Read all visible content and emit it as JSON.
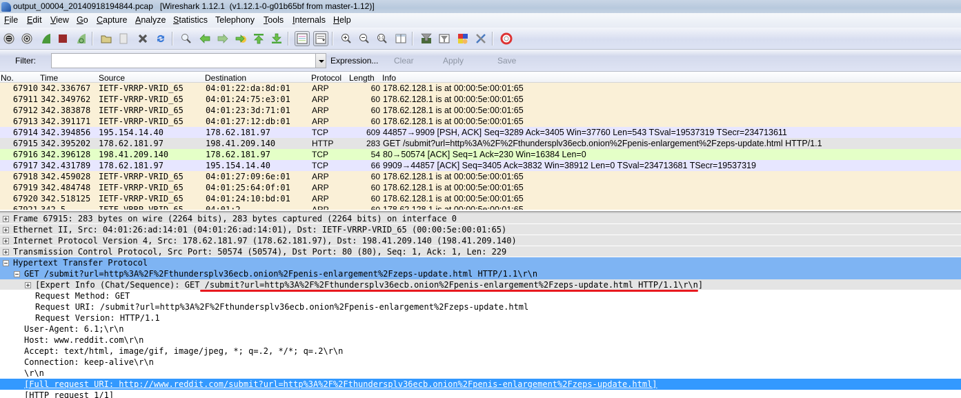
{
  "window": {
    "title": "output_00004_20140918194844.pcap   [Wireshark 1.12.1  (v1.12.1-0-g01b65bf from master-1.12)]"
  },
  "menubar": {
    "items": [
      {
        "label": "File",
        "accel": "F",
        "rest": "ile"
      },
      {
        "label": "Edit",
        "accel": "E",
        "rest": "dit"
      },
      {
        "label": "View",
        "accel": "V",
        "rest": "iew"
      },
      {
        "label": "Go",
        "accel": "G",
        "rest": "o"
      },
      {
        "label": "Capture",
        "accel": "C",
        "rest": "apture"
      },
      {
        "label": "Analyze",
        "accel": "A",
        "rest": "nalyze"
      },
      {
        "label": "Statistics",
        "accel": "S",
        "rest": "tatistics"
      },
      {
        "label": "Telephony",
        "accel": "",
        "rest": "Telephony"
      },
      {
        "label": "Tools",
        "accel": "T",
        "rest": "ools"
      },
      {
        "label": "Internals",
        "accel": "I",
        "rest": "nternals"
      },
      {
        "label": "Help",
        "accel": "H",
        "rest": "elp"
      }
    ]
  },
  "toolbar": {
    "buttons": [
      "interfaces-icon",
      "capture-options-icon",
      "start-capture-icon",
      "stop-capture-icon",
      "restart-capture-icon",
      "open-file-icon",
      "save-file-icon",
      "close-file-icon",
      "reload-icon",
      "find-packet-icon",
      "go-back-icon",
      "go-forward-icon",
      "go-to-packet-icon",
      "first-packet-icon",
      "last-packet-icon",
      "colorize-icon",
      "auto-scroll-icon",
      "zoom-in-icon",
      "zoom-out-icon",
      "normal-size-icon",
      "resize-columns-icon",
      "capture-filters-icon",
      "display-filters-icon",
      "coloring-rules-icon",
      "preferences-icon",
      "help-icon"
    ]
  },
  "filter": {
    "label": "Filter:",
    "value": "",
    "expression_label": "Expression...",
    "clear_label": "Clear",
    "apply_label": "Apply",
    "save_label": "Save"
  },
  "packet_list": {
    "columns": [
      "No.",
      "Time",
      "Source",
      "Destination",
      "Protocol",
      "Length",
      "Info"
    ],
    "colors": {
      "arp": "#faf0d7",
      "tcp": "#e7e6ff",
      "http": "#e4e4e4",
      "tcp_ack": "#e4ffc7"
    },
    "rows": [
      {
        "no": "67910",
        "time": "342.336767",
        "src": "IETF-VRRP-VRID_65",
        "dst": "04:01:22:da:8d:01",
        "proto": "ARP",
        "len": "60",
        "info": "178.62.128.1 is at 00:00:5e:00:01:65",
        "color": "arp"
      },
      {
        "no": "67911",
        "time": "342.349762",
        "src": "IETF-VRRP-VRID_65",
        "dst": "04:01:24:75:e3:01",
        "proto": "ARP",
        "len": "60",
        "info": "178.62.128.1 is at 00:00:5e:00:01:65",
        "color": "arp"
      },
      {
        "no": "67912",
        "time": "342.383878",
        "src": "IETF-VRRP-VRID_65",
        "dst": "04:01:23:3d:71:01",
        "proto": "ARP",
        "len": "60",
        "info": "178.62.128.1 is at 00:00:5e:00:01:65",
        "color": "arp"
      },
      {
        "no": "67913",
        "time": "342.391171",
        "src": "IETF-VRRP-VRID_65",
        "dst": "04:01:27:12:db:01",
        "proto": "ARP",
        "len": "60",
        "info": "178.62.128.1 is at 00:00:5e:00:01:65",
        "color": "arp"
      },
      {
        "no": "67914",
        "time": "342.394856",
        "src": "195.154.14.40",
        "dst": "178.62.181.97",
        "proto": "TCP",
        "len": "609",
        "info": "44857→9909 [PSH, ACK] Seq=3289 Ack=3405 Win=37760 Len=543 TSval=19537319 TSecr=234713611",
        "color": "tcp"
      },
      {
        "no": "67915",
        "time": "342.395202",
        "src": "178.62.181.97",
        "dst": "198.41.209.140",
        "proto": "HTTP",
        "len": "283",
        "info": "GET /submit?url=http%3A%2F%2Fthundersplv36ecb.onion%2Fpenis-enlargement%2Fzeps-update.html HTTP/1.1",
        "color": "http"
      },
      {
        "no": "67916",
        "time": "342.396128",
        "src": "198.41.209.140",
        "dst": "178.62.181.97",
        "proto": "TCP",
        "len": "54",
        "info": "80→50574 [ACK] Seq=1 Ack=230 Win=16384 Len=0",
        "color": "tcp_ack"
      },
      {
        "no": "67917",
        "time": "342.431789",
        "src": "178.62.181.97",
        "dst": "195.154.14.40",
        "proto": "TCP",
        "len": "66",
        "info": "9909→44857 [ACK] Seq=3405 Ack=3832 Win=38912 Len=0 TSval=234713681 TSecr=19537319",
        "color": "tcp"
      },
      {
        "no": "67918",
        "time": "342.459028",
        "src": "IETF-VRRP-VRID_65",
        "dst": "04:01:27:09:6e:01",
        "proto": "ARP",
        "len": "60",
        "info": "178.62.128.1 is at 00:00:5e:00:01:65",
        "color": "arp"
      },
      {
        "no": "67919",
        "time": "342.484748",
        "src": "IETF-VRRP-VRID_65",
        "dst": "04:01:25:64:0f:01",
        "proto": "ARP",
        "len": "60",
        "info": "178.62.128.1 is at 00:00:5e:00:01:65",
        "color": "arp"
      },
      {
        "no": "67920",
        "time": "342.518125",
        "src": "IETF-VRRP-VRID_65",
        "dst": "04:01:24:10:bd:01",
        "proto": "ARP",
        "len": "60",
        "info": "178.62.128.1 is at 00:00:5e:00:01:65",
        "color": "arp"
      },
      {
        "no": "67921",
        "time": "342.5",
        "src": "IETF-VRRP-VRID_65",
        "dst": "04:01:2",
        "proto": "ARP",
        "len": "60",
        "info": "178.62.128.1 is at 00:00:5e:00:01:65",
        "color": "arp",
        "partial": true
      }
    ]
  },
  "details": {
    "rows": [
      {
        "indent": 0,
        "expander": "plus",
        "style": "hdr",
        "text": "Frame 67915: 283 bytes on wire (2264 bits), 283 bytes captured (2264 bits) on interface 0"
      },
      {
        "indent": 0,
        "expander": "plus",
        "style": "hdr",
        "text": "Ethernet II, Src: 04:01:26:ad:14:01 (04:01:26:ad:14:01), Dst: IETF-VRRP-VRID_65 (00:00:5e:00:01:65)"
      },
      {
        "indent": 0,
        "expander": "plus",
        "style": "hdr",
        "text": "Internet Protocol Version 4, Src: 178.62.181.97 (178.62.181.97), Dst: 198.41.209.140 (198.41.209.140)"
      },
      {
        "indent": 0,
        "expander": "plus",
        "style": "hdr",
        "text": "Transmission Control Protocol, Src Port: 50574 (50574), Dst Port: 80 (80), Seq: 1, Ack: 1, Len: 229"
      },
      {
        "indent": 0,
        "expander": "minus",
        "style": "sel",
        "text": "Hypertext Transfer Protocol"
      },
      {
        "indent": 1,
        "expander": "minus",
        "style": "sel",
        "text": "GET /submit?url=http%3A%2F%2Fthundersplv36ecb.onion%2Fpenis-enlargement%2Fzeps-update.html HTTP/1.1\\r\\n"
      },
      {
        "indent": 2,
        "expander": "plus",
        "style": "hdr",
        "text": "[Expert Info (Chat/Sequence): GET /submit?url=http%3A%2F%2Fthundersplv36ecb.onion%2Fpenis-enlargement%2Fzeps-update.html HTTP/1.1\\r\\n]"
      },
      {
        "indent": 3,
        "expander": "",
        "style": "",
        "text": "Request Method: GET"
      },
      {
        "indent": 3,
        "expander": "",
        "style": "",
        "text": "Request URI: /submit?url=http%3A%2F%2Fthundersplv36ecb.onion%2Fpenis-enlargement%2Fzeps-update.html"
      },
      {
        "indent": 3,
        "expander": "",
        "style": "",
        "text": "Request Version: HTTP/1.1"
      },
      {
        "indent": 2,
        "expander": "",
        "style": "",
        "text": "User-Agent: 6.1;\\r\\n"
      },
      {
        "indent": 2,
        "expander": "",
        "style": "",
        "text": "Host: www.reddit.com\\r\\n"
      },
      {
        "indent": 2,
        "expander": "",
        "style": "",
        "text": "Accept: text/html, image/gif, image/jpeg, *; q=.2, */*; q=.2\\r\\n"
      },
      {
        "indent": 2,
        "expander": "",
        "style": "",
        "text": "Connection: keep-alive\\r\\n"
      },
      {
        "indent": 2,
        "expander": "",
        "style": "",
        "text": "\\r\\n"
      },
      {
        "indent": 2,
        "expander": "",
        "style": "sel-strong",
        "text": "[Full request URI: http://www.reddit.com/submit?url=http%3A%2F%2Fthundersplv36ecb.onion%2Fpenis-enlargement%2Fzeps-update.html]"
      },
      {
        "indent": 2,
        "expander": "",
        "style": "",
        "text": "[HTTP request 1/1]"
      }
    ],
    "annotation": {
      "type": "red-underline",
      "target": "expert-info GET request URI",
      "color": "#e8191f"
    }
  }
}
